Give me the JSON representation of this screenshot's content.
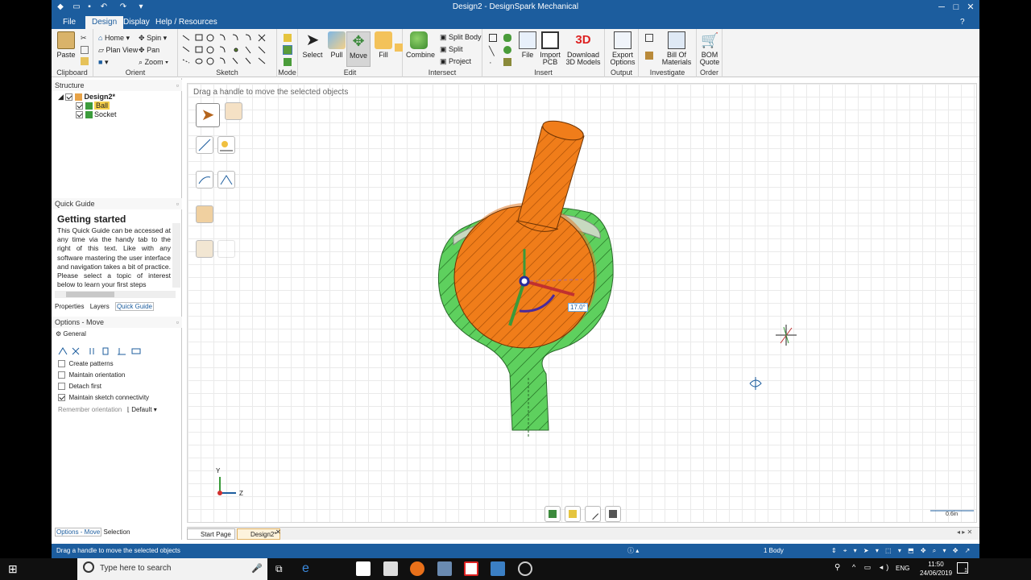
{
  "window": {
    "title": "Design2 - DesignSpark Mechanical",
    "minimize": "─",
    "maximize": "□",
    "close": "✕"
  },
  "menu": {
    "tabs": [
      "File",
      "Design",
      "Display",
      "Help / Resources"
    ],
    "active": "Design"
  },
  "ribbon": {
    "groups": {
      "clipboard": "Clipboard",
      "orient": "Orient",
      "sketch": "Sketch",
      "mode": "Mode",
      "edit": "Edit",
      "intersect": "Intersect",
      "insert": "Insert",
      "output": "Output",
      "investigate": "Investigate",
      "order": "Order"
    },
    "paste": "Paste",
    "home": "Home",
    "spin": "Spin",
    "plan_view": "Plan View",
    "pan": "Pan",
    "zoom": "Zoom",
    "select": "Select",
    "pull": "Pull",
    "move": "Move",
    "fill": "Fill",
    "combine": "Combine",
    "split_body": "Split Body",
    "split": "Split",
    "project": "Project",
    "file": "File",
    "import_pcb": "Import PCB",
    "download_3d": "Download 3D Models",
    "download_3d_badge": "3D",
    "export_options": "Export Options",
    "bill_of_materials": "Bill Of Materials",
    "bom_quote": "BOM Quote"
  },
  "structure": {
    "header": "Structure",
    "root": "Design2*",
    "items": [
      "Ball",
      "Socket"
    ]
  },
  "quick_guide": {
    "header": "Quick Guide",
    "title": "Getting started",
    "body": "This Quick Guide can be accessed at any time via the handy tab to the right of this text. Like with any software mastering the user interface and navigation takes a bit of practice. Please select a topic of interest below to learn your first steps",
    "tabs": [
      "Properties",
      "Layers",
      "Quick Guide"
    ]
  },
  "options": {
    "header": "Options - Move",
    "general": "General",
    "checkboxes": [
      {
        "label": "Create patterns",
        "checked": false
      },
      {
        "label": "Maintain orientation",
        "checked": false
      },
      {
        "label": "Detach first",
        "checked": false
      },
      {
        "label": "Maintain sketch connectivity",
        "checked": true
      }
    ],
    "remember_orientation": "Remember orientation",
    "remember_value": "Default"
  },
  "viewport": {
    "hint": "Drag a handle to move the selected objects",
    "angle_label": "17.0°",
    "axis_y": "Y",
    "axis_z": "Z",
    "scale_label": "0.6in"
  },
  "bottom_tabs": {
    "left": [
      "Options - Move",
      "Selection"
    ],
    "docs": [
      "Start Page",
      "Design2*"
    ]
  },
  "statusbar": {
    "message": "Drag a handle to move the selected objects",
    "body_count": "1 Body"
  },
  "taskbar": {
    "search_placeholder": "Type here to search",
    "language": "ENG",
    "time": "11:50",
    "date": "24/06/2019",
    "notification_count": "1"
  },
  "colors": {
    "accent": "#1c5d9e",
    "ball": "#f07d1a",
    "socket": "#5ed05e"
  }
}
